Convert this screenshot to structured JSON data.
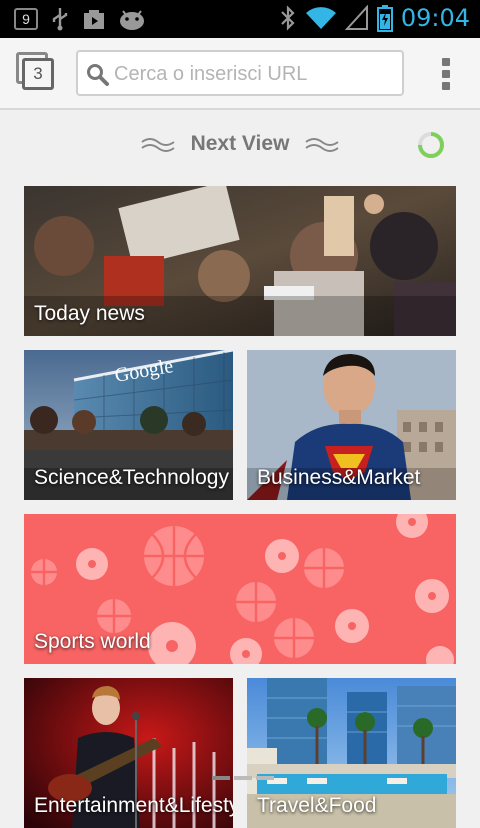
{
  "status_bar": {
    "notification_count": "9",
    "time": "09:04",
    "icons": [
      "notification-badge",
      "usb-icon",
      "play-store-icon",
      "android-debug-icon",
      "bluetooth-icon",
      "wifi-icon",
      "signal-icon",
      "battery-icon"
    ]
  },
  "toolbar": {
    "tab_count": "3",
    "url_placeholder": "Cerca o inserisci URL",
    "url_value": ""
  },
  "next_view": {
    "title": "Next View"
  },
  "tiles": [
    {
      "label": "Today news"
    },
    {
      "label": "Science&Technology"
    },
    {
      "label": "Business&Market"
    },
    {
      "label": "Sports world"
    },
    {
      "label": "Entertainment&Lifestyle"
    },
    {
      "label": "Travel&Food"
    }
  ],
  "colors": {
    "accent_blue": "#33b5e5",
    "spinner_green": "#7ed05a",
    "sports_tile": "#f86464"
  }
}
